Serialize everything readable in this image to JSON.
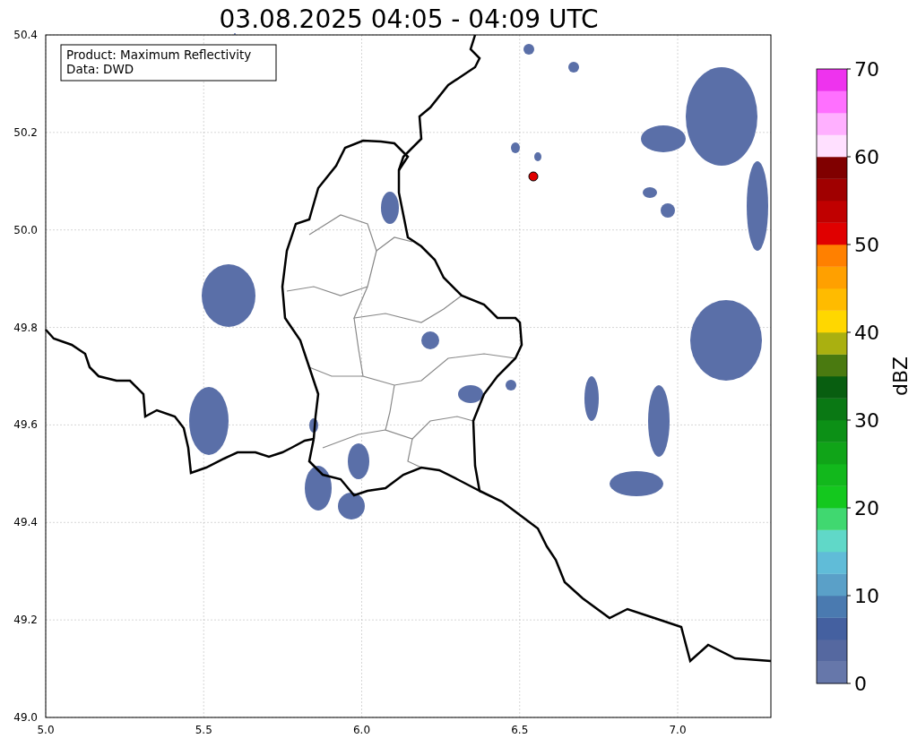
{
  "title": "03.08.2025 04:05 - 04:09 UTC",
  "annotation": {
    "lines": [
      "Product: Maximum Reflectivity",
      "Data: DWD"
    ]
  },
  "map": {
    "xticks": [
      "5.0",
      "5.5",
      "6.0",
      "6.5",
      "7.0"
    ],
    "yticks": [
      "50.4",
      "50.2",
      "50.0",
      "49.8",
      "49.6",
      "49.4",
      "49.2",
      "49.0"
    ]
  },
  "colorbar": {
    "label": "dBZ",
    "ticks": [
      "70",
      "60",
      "50",
      "40",
      "30",
      "20",
      "10",
      "0"
    ],
    "segments": [
      {
        "color": "#6677aa"
      },
      {
        "color": "#5568a0"
      },
      {
        "color": "#4460a0"
      },
      {
        "color": "#4a7ab0"
      },
      {
        "color": "#5aa0c8"
      },
      {
        "color": "#60bcd8"
      },
      {
        "color": "#60d8c8"
      },
      {
        "color": "#40d870"
      },
      {
        "color": "#14c81e"
      },
      {
        "color": "#12b81c"
      },
      {
        "color": "#10a418"
      },
      {
        "color": "#0c9016"
      },
      {
        "color": "#0a7814"
      },
      {
        "color": "#085e10"
      },
      {
        "color": "#4a7a10"
      },
      {
        "color": "#aab010"
      },
      {
        "color": "#ffd700"
      },
      {
        "color": "#ffbb00"
      },
      {
        "color": "#ffa000"
      },
      {
        "color": "#ff8000"
      },
      {
        "color": "#e00000"
      },
      {
        "color": "#c00000"
      },
      {
        "color": "#a00000"
      },
      {
        "color": "#800000"
      },
      {
        "color": "#ffe0ff"
      },
      {
        "color": "#ffb0ff"
      },
      {
        "color": "#ff70ff"
      },
      {
        "color": "#ee33ee"
      }
    ]
  }
}
